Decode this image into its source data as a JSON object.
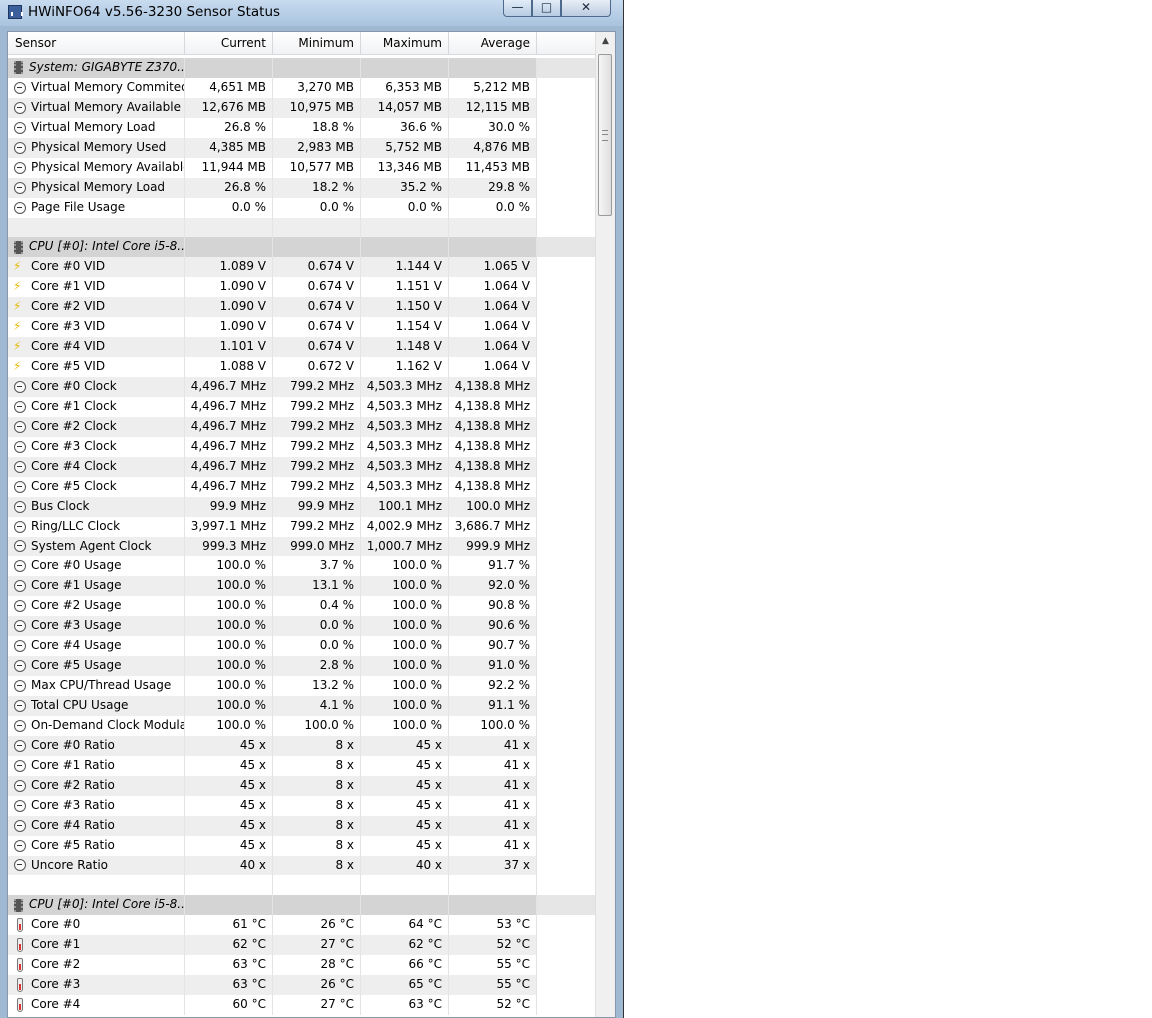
{
  "window": {
    "title": "HWiNFO64 v5.56-3230 Sensor Status"
  },
  "columns": {
    "sensor": "Sensor",
    "current": "Current",
    "minimum": "Minimum",
    "maximum": "Maximum",
    "average": "Average"
  },
  "rows": [
    {
      "kind": "group",
      "icon": "chip-icon",
      "name": "System: GIGABYTE Z370..."
    },
    {
      "kind": "data",
      "icon": "clock",
      "name": "Virtual Memory Commited",
      "cur": "4,651 MB",
      "min": "3,270 MB",
      "max": "6,353 MB",
      "avg": "5,212 MB"
    },
    {
      "kind": "data",
      "icon": "clock",
      "name": "Virtual Memory Available",
      "cur": "12,676 MB",
      "min": "10,975 MB",
      "max": "14,057 MB",
      "avg": "12,115 MB"
    },
    {
      "kind": "data",
      "icon": "clock",
      "name": "Virtual Memory Load",
      "cur": "26.8 %",
      "min": "18.8 %",
      "max": "36.6 %",
      "avg": "30.0 %"
    },
    {
      "kind": "data",
      "icon": "clock",
      "name": "Physical Memory Used",
      "cur": "4,385 MB",
      "min": "2,983 MB",
      "max": "5,752 MB",
      "avg": "4,876 MB"
    },
    {
      "kind": "data",
      "icon": "clock",
      "name": "Physical Memory Available",
      "cur": "11,944 MB",
      "min": "10,577 MB",
      "max": "13,346 MB",
      "avg": "11,453 MB"
    },
    {
      "kind": "data",
      "icon": "clock",
      "name": "Physical Memory Load",
      "cur": "26.8 %",
      "min": "18.2 %",
      "max": "35.2 %",
      "avg": "29.8 %"
    },
    {
      "kind": "data",
      "icon": "clock",
      "name": "Page File Usage",
      "cur": "0.0 %",
      "min": "0.0 %",
      "max": "0.0 %",
      "avg": "0.0 %"
    },
    {
      "kind": "blank"
    },
    {
      "kind": "group",
      "icon": "chip-icon",
      "name": "CPU [#0]: Intel Core i5-8..."
    },
    {
      "kind": "data",
      "icon": "volt",
      "name": "Core #0 VID",
      "cur": "1.089 V",
      "min": "0.674 V",
      "max": "1.144 V",
      "avg": "1.065 V"
    },
    {
      "kind": "data",
      "icon": "volt",
      "name": "Core #1 VID",
      "cur": "1.090 V",
      "min": "0.674 V",
      "max": "1.151 V",
      "avg": "1.064 V"
    },
    {
      "kind": "data",
      "icon": "volt",
      "name": "Core #2 VID",
      "cur": "1.090 V",
      "min": "0.674 V",
      "max": "1.150 V",
      "avg": "1.064 V"
    },
    {
      "kind": "data",
      "icon": "volt",
      "name": "Core #3 VID",
      "cur": "1.090 V",
      "min": "0.674 V",
      "max": "1.154 V",
      "avg": "1.064 V"
    },
    {
      "kind": "data",
      "icon": "volt",
      "name": "Core #4 VID",
      "cur": "1.101 V",
      "min": "0.674 V",
      "max": "1.148 V",
      "avg": "1.064 V"
    },
    {
      "kind": "data",
      "icon": "volt",
      "name": "Core #5 VID",
      "cur": "1.088 V",
      "min": "0.672 V",
      "max": "1.162 V",
      "avg": "1.064 V"
    },
    {
      "kind": "data",
      "icon": "clock",
      "name": "Core #0 Clock",
      "cur": "4,496.7 MHz",
      "min": "799.2 MHz",
      "max": "4,503.3 MHz",
      "avg": "4,138.8 MHz"
    },
    {
      "kind": "data",
      "icon": "clock",
      "name": "Core #1 Clock",
      "cur": "4,496.7 MHz",
      "min": "799.2 MHz",
      "max": "4,503.3 MHz",
      "avg": "4,138.8 MHz"
    },
    {
      "kind": "data",
      "icon": "clock",
      "name": "Core #2 Clock",
      "cur": "4,496.7 MHz",
      "min": "799.2 MHz",
      "max": "4,503.3 MHz",
      "avg": "4,138.8 MHz"
    },
    {
      "kind": "data",
      "icon": "clock",
      "name": "Core #3 Clock",
      "cur": "4,496.7 MHz",
      "min": "799.2 MHz",
      "max": "4,503.3 MHz",
      "avg": "4,138.8 MHz"
    },
    {
      "kind": "data",
      "icon": "clock",
      "name": "Core #4 Clock",
      "cur": "4,496.7 MHz",
      "min": "799.2 MHz",
      "max": "4,503.3 MHz",
      "avg": "4,138.8 MHz"
    },
    {
      "kind": "data",
      "icon": "clock",
      "name": "Core #5 Clock",
      "cur": "4,496.7 MHz",
      "min": "799.2 MHz",
      "max": "4,503.3 MHz",
      "avg": "4,138.8 MHz"
    },
    {
      "kind": "data",
      "icon": "clock",
      "name": "Bus Clock",
      "cur": "99.9 MHz",
      "min": "99.9 MHz",
      "max": "100.1 MHz",
      "avg": "100.0 MHz"
    },
    {
      "kind": "data",
      "icon": "clock",
      "name": "Ring/LLC Clock",
      "cur": "3,997.1 MHz",
      "min": "799.2 MHz",
      "max": "4,002.9 MHz",
      "avg": "3,686.7 MHz"
    },
    {
      "kind": "data",
      "icon": "clock",
      "name": "System Agent Clock",
      "cur": "999.3 MHz",
      "min": "999.0 MHz",
      "max": "1,000.7 MHz",
      "avg": "999.9 MHz"
    },
    {
      "kind": "data",
      "icon": "clock",
      "name": "Core #0 Usage",
      "cur": "100.0 %",
      "min": "3.7 %",
      "max": "100.0 %",
      "avg": "91.7 %"
    },
    {
      "kind": "data",
      "icon": "clock",
      "name": "Core #1 Usage",
      "cur": "100.0 %",
      "min": "13.1 %",
      "max": "100.0 %",
      "avg": "92.0 %"
    },
    {
      "kind": "data",
      "icon": "clock",
      "name": "Core #2 Usage",
      "cur": "100.0 %",
      "min": "0.4 %",
      "max": "100.0 %",
      "avg": "90.8 %"
    },
    {
      "kind": "data",
      "icon": "clock",
      "name": "Core #3 Usage",
      "cur": "100.0 %",
      "min": "0.0 %",
      "max": "100.0 %",
      "avg": "90.6 %"
    },
    {
      "kind": "data",
      "icon": "clock",
      "name": "Core #4 Usage",
      "cur": "100.0 %",
      "min": "0.0 %",
      "max": "100.0 %",
      "avg": "90.7 %"
    },
    {
      "kind": "data",
      "icon": "clock",
      "name": "Core #5 Usage",
      "cur": "100.0 %",
      "min": "2.8 %",
      "max": "100.0 %",
      "avg": "91.0 %"
    },
    {
      "kind": "data",
      "icon": "clock",
      "name": "Max CPU/Thread Usage",
      "cur": "100.0 %",
      "min": "13.2 %",
      "max": "100.0 %",
      "avg": "92.2 %"
    },
    {
      "kind": "data",
      "icon": "clock",
      "name": "Total CPU Usage",
      "cur": "100.0 %",
      "min": "4.1 %",
      "max": "100.0 %",
      "avg": "91.1 %"
    },
    {
      "kind": "data",
      "icon": "clock",
      "name": "On-Demand Clock Modula...",
      "cur": "100.0 %",
      "min": "100.0 %",
      "max": "100.0 %",
      "avg": "100.0 %"
    },
    {
      "kind": "data",
      "icon": "clock",
      "name": "Core #0 Ratio",
      "cur": "45 x",
      "min": "8 x",
      "max": "45 x",
      "avg": "41 x"
    },
    {
      "kind": "data",
      "icon": "clock",
      "name": "Core #1 Ratio",
      "cur": "45 x",
      "min": "8 x",
      "max": "45 x",
      "avg": "41 x"
    },
    {
      "kind": "data",
      "icon": "clock",
      "name": "Core #2 Ratio",
      "cur": "45 x",
      "min": "8 x",
      "max": "45 x",
      "avg": "41 x"
    },
    {
      "kind": "data",
      "icon": "clock",
      "name": "Core #3 Ratio",
      "cur": "45 x",
      "min": "8 x",
      "max": "45 x",
      "avg": "41 x"
    },
    {
      "kind": "data",
      "icon": "clock",
      "name": "Core #4 Ratio",
      "cur": "45 x",
      "min": "8 x",
      "max": "45 x",
      "avg": "41 x"
    },
    {
      "kind": "data",
      "icon": "clock",
      "name": "Core #5 Ratio",
      "cur": "45 x",
      "min": "8 x",
      "max": "45 x",
      "avg": "41 x"
    },
    {
      "kind": "data",
      "icon": "clock",
      "name": "Uncore Ratio",
      "cur": "40 x",
      "min": "8 x",
      "max": "40 x",
      "avg": "37 x"
    },
    {
      "kind": "blank"
    },
    {
      "kind": "group",
      "icon": "chip-icon",
      "name": "CPU [#0]: Intel Core i5-8..."
    },
    {
      "kind": "data",
      "icon": "temp",
      "name": "Core #0",
      "cur": "61 °C",
      "min": "26 °C",
      "max": "64 °C",
      "avg": "53 °C"
    },
    {
      "kind": "data",
      "icon": "temp",
      "name": "Core #1",
      "cur": "62 °C",
      "min": "27 °C",
      "max": "62 °C",
      "avg": "52 °C"
    },
    {
      "kind": "data",
      "icon": "temp",
      "name": "Core #2",
      "cur": "63 °C",
      "min": "28 °C",
      "max": "66 °C",
      "avg": "55 °C"
    },
    {
      "kind": "data",
      "icon": "temp",
      "name": "Core #3",
      "cur": "63 °C",
      "min": "26 °C",
      "max": "65 °C",
      "avg": "55 °C"
    },
    {
      "kind": "data",
      "icon": "temp",
      "name": "Core #4",
      "cur": "60 °C",
      "min": "27 °C",
      "max": "63 °C",
      "avg": "52 °C"
    }
  ]
}
